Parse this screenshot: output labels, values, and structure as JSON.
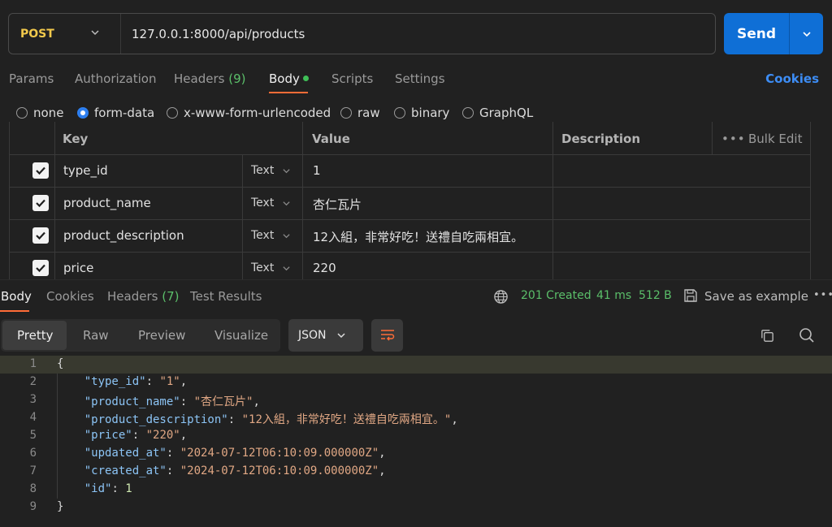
{
  "request": {
    "method": "POST",
    "url": "127.0.0.1:8000/api/products",
    "send_label": "Send"
  },
  "req_tabs": {
    "params": "Params",
    "authorization": "Authorization",
    "headers": "Headers",
    "headers_count": "(9)",
    "body": "Body",
    "scripts": "Scripts",
    "settings": "Settings",
    "cookies": "Cookies"
  },
  "body_types": {
    "none": "none",
    "form_data": "form-data",
    "urlencoded": "x-www-form-urlencoded",
    "raw": "raw",
    "binary": "binary",
    "graphql": "GraphQL",
    "selected": "form-data"
  },
  "params_table": {
    "headers": {
      "key": "Key",
      "value": "Value",
      "description": "Description",
      "bulk_edit": "Bulk Edit"
    },
    "rows": [
      {
        "checked": true,
        "key": "type_id",
        "type": "Text",
        "value": "1"
      },
      {
        "checked": true,
        "key": "product_name",
        "type": "Text",
        "value": "杏仁瓦片"
      },
      {
        "checked": true,
        "key": "product_description",
        "type": "Text",
        "value": "12入組，非常好吃！送禮自吃兩相宜。"
      },
      {
        "checked": true,
        "key": "price",
        "type": "Text",
        "value": "220"
      }
    ]
  },
  "response": {
    "tabs": {
      "body": "Body",
      "cookies": "Cookies",
      "headers": "Headers",
      "headers_count": "(7)",
      "test_results": "Test Results"
    },
    "status": "201 Created",
    "time": "41 ms",
    "size": "512 B",
    "save_example": "Save as example",
    "formats": {
      "pretty": "Pretty",
      "raw": "Raw",
      "preview": "Preview",
      "visualize": "Visualize"
    },
    "language": "JSON",
    "lines": [
      {
        "num": "1",
        "open": "{"
      },
      {
        "num": "2",
        "key": "\"type_id\"",
        "val": "\"1\"",
        "comma": ","
      },
      {
        "num": "3",
        "key": "\"product_name\"",
        "val": "\"杏仁瓦片\"",
        "comma": ","
      },
      {
        "num": "4",
        "key": "\"product_description\"",
        "val": "\"12入組，非常好吃！送禮自吃兩相宜。\"",
        "comma": ","
      },
      {
        "num": "5",
        "key": "\"price\"",
        "val": "\"220\"",
        "comma": ","
      },
      {
        "num": "6",
        "key": "\"updated_at\"",
        "val": "\"2024-07-12T06:10:09.000000Z\"",
        "comma": ","
      },
      {
        "num": "7",
        "key": "\"created_at\"",
        "val": "\"2024-07-12T06:10:09.000000Z\"",
        "comma": ","
      },
      {
        "num": "8",
        "key": "\"id\"",
        "val": "1",
        "comma": ""
      },
      {
        "num": "9",
        "close": "}"
      }
    ]
  },
  "colors": {
    "accent_orange": "#ff6c37",
    "send_blue": "#0f6fd6",
    "status_green": "#5bbf6a",
    "method_yellow": "#f2c94c"
  }
}
